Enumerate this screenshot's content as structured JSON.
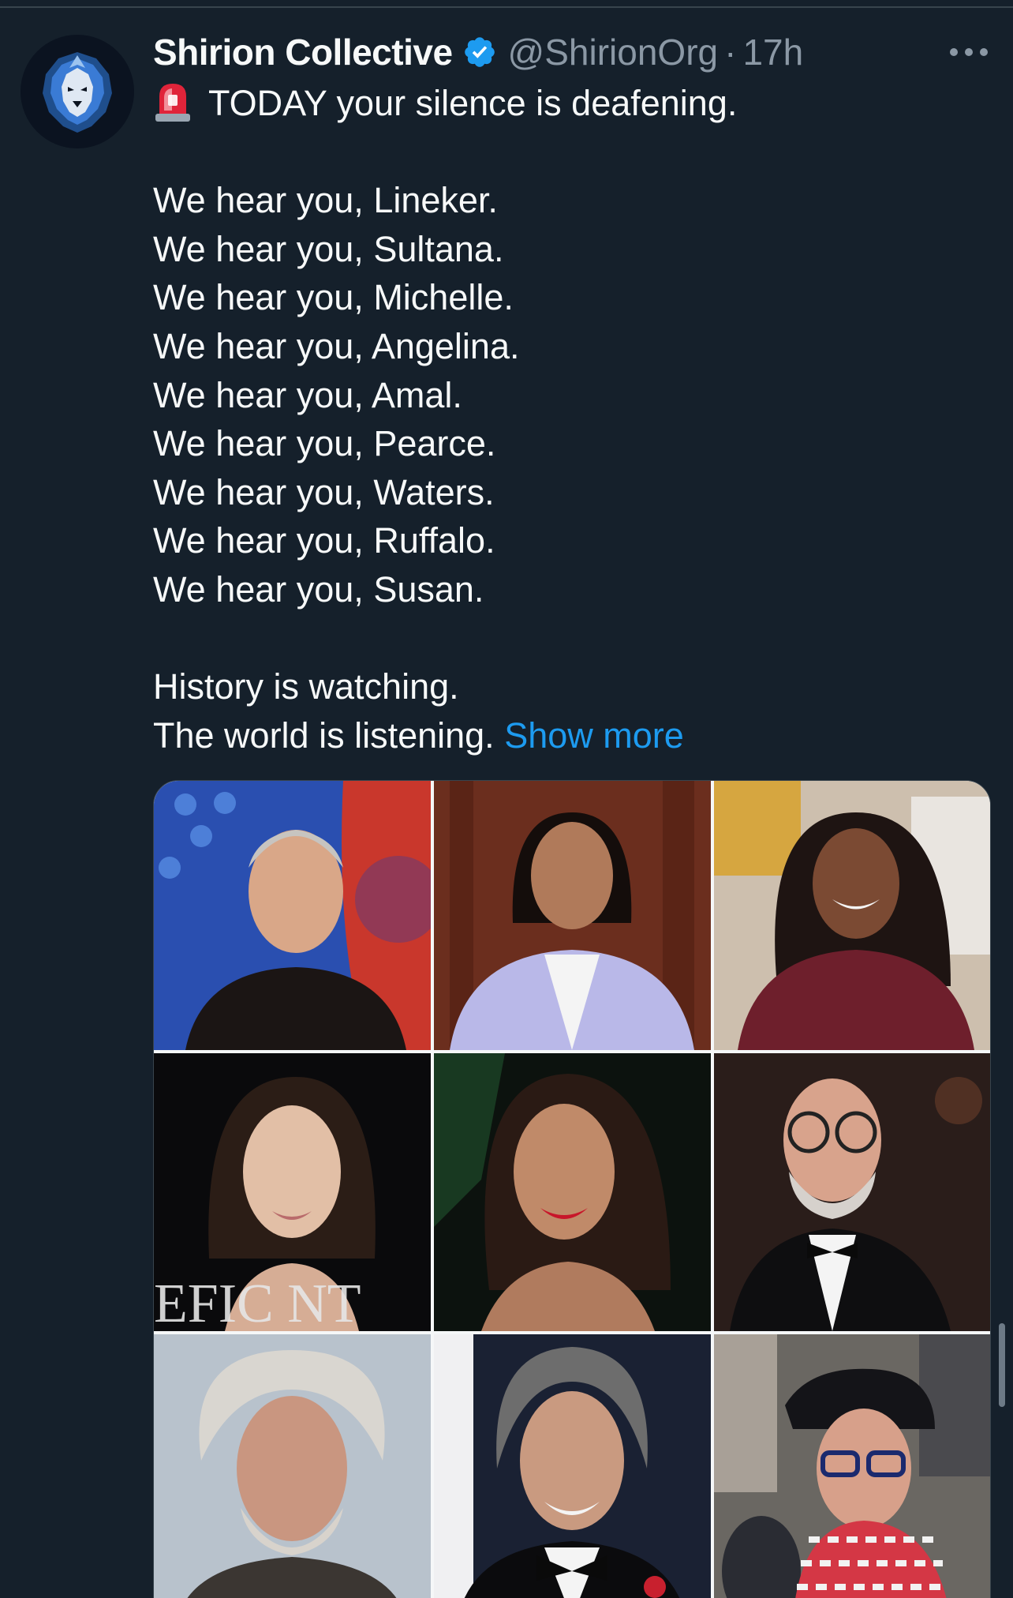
{
  "tweet": {
    "author": {
      "display_name": "Shirion Collective",
      "handle": "@ShirionOrg",
      "separator": "·",
      "time": "17h",
      "verified": true,
      "avatar_icon": "lion-avatar-icon"
    },
    "more_icon": "more-options-icon",
    "text": {
      "headline_emoji": "siren-emoji-icon",
      "headline": "TODAY your silence is deafening.",
      "lines": [
        "We hear you, Lineker.",
        "We hear you, Sultana.",
        "We hear you, Michelle.",
        "We hear you, Angelina.",
        "We hear you, Amal.",
        "We hear you, Pearce.",
        "We hear you, Waters.",
        "We hear you, Ruffalo.",
        "We hear you, Susan."
      ],
      "closing_1": "History is watching.",
      "closing_2": "The world is listening.",
      "show_more": "Show more"
    },
    "media": {
      "count": 9,
      "layout": "3x3 grid"
    }
  },
  "colors": {
    "background": "#15202b",
    "text": "#f7f9f9",
    "muted": "#8b98a5",
    "link": "#1d9bf0",
    "verified": "#1d9bf0"
  }
}
